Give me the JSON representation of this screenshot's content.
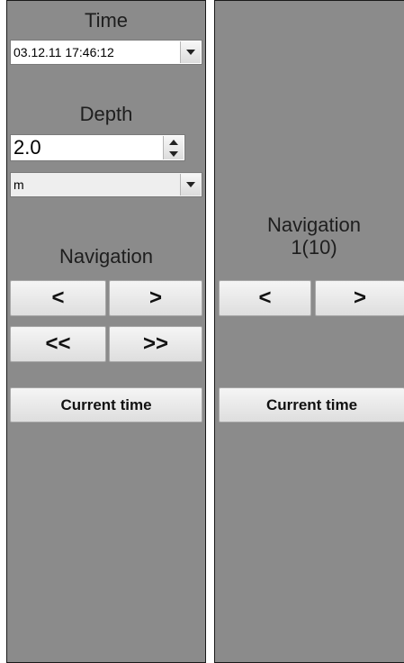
{
  "left_panel": {
    "time_label": "Time",
    "time_value": "03.12.11 17:46:12",
    "depth_label": "Depth",
    "depth_value": "2.0",
    "unit_value": "m",
    "navigation_label": "Navigation",
    "prev_label": "<",
    "next_label": ">",
    "fast_prev_label": "<<",
    "fast_next_label": ">>",
    "current_time_label": "Current time"
  },
  "right_panel": {
    "navigation_label": "Navigation",
    "navigation_counter": "1(10)",
    "prev_label": "<",
    "next_label": ">",
    "current_time_label": "Current time"
  }
}
